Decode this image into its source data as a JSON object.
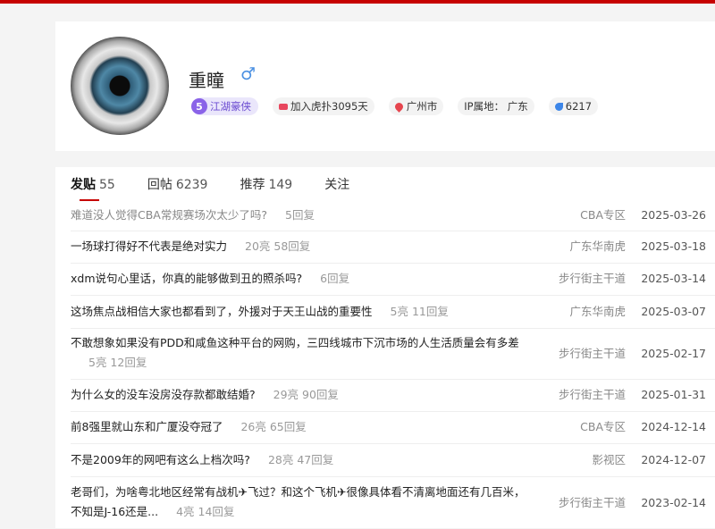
{
  "profile": {
    "username": "重瞳",
    "gender_symbol": "♂",
    "level": "5",
    "level_title": "江湖豪侠",
    "joined": "加入虎扑3095天",
    "city": "广州市",
    "ip_location": "IP属地： 广东",
    "points": "6217"
  },
  "tabs": [
    {
      "label": "发贴",
      "count": "55"
    },
    {
      "label": "回帖",
      "count": "6239"
    },
    {
      "label": "推荐",
      "count": "149"
    },
    {
      "label": "关注",
      "count": ""
    }
  ],
  "posts": [
    {
      "title": "难道没人觉得CBA常规赛场次太少了吗?",
      "meta": "5回复",
      "section": "CBA专区",
      "date": "2025-03-26"
    },
    {
      "title": "一场球打得好不代表是绝对实力",
      "meta": "20亮 58回复",
      "section": "广东华南虎",
      "date": "2025-03-18"
    },
    {
      "title": "xdm说句心里话，你真的能够做到丑的照杀吗?",
      "meta": "6回复",
      "section": "步行街主干道",
      "date": "2025-03-14"
    },
    {
      "title": "这场焦点战相信大家也都看到了，外援对于天王山战的重要性",
      "meta": "5亮 11回复",
      "section": "广东华南虎",
      "date": "2025-03-07"
    },
    {
      "title": "不敢想象如果没有PDD和咸鱼这种平台的网购，三四线城市下沉市场的人生活质量会有多差",
      "meta": "5亮 12回复",
      "section": "步行街主干道",
      "date": "2025-02-17"
    },
    {
      "title": "为什么女的没车没房没存款都敢结婚?",
      "meta": "29亮 90回复",
      "section": "步行街主干道",
      "date": "2025-01-31"
    },
    {
      "title": "前8强里就山东和广厦没夺冠了",
      "meta": "26亮 65回复",
      "section": "CBA专区",
      "date": "2024-12-14"
    },
    {
      "title": "不是2009年的网吧有这么上档次吗?",
      "meta": "28亮 47回复",
      "section": "影视区",
      "date": "2024-12-07"
    },
    {
      "title": "老哥们，为啥粤北地区经常有战机✈飞过？和这个飞机✈很像具体看不清离地面还有几百米，不知是J-16还是...",
      "meta": "4亮 14回复",
      "section": "步行街主干道",
      "date": "2023-02-14"
    }
  ]
}
